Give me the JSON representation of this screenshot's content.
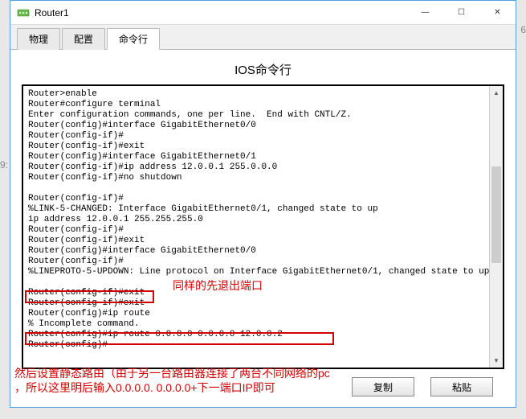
{
  "window": {
    "title": "Router1"
  },
  "tabs": {
    "items": [
      {
        "label": "物理"
      },
      {
        "label": "配置"
      },
      {
        "label": "命令行"
      }
    ]
  },
  "heading": "IOS命令行",
  "terminal": {
    "lines": "Router>enable\nRouter#configure terminal\nEnter configuration commands, one per line.  End with CNTL/Z.\nRouter(config)#interface GigabitEthernet0/0\nRouter(config-if)#\nRouter(config-if)#exit\nRouter(config)#interface GigabitEthernet0/1\nRouter(config-if)#ip address 12.0.0.1 255.0.0.0\nRouter(config-if)#no shutdown\n\nRouter(config-if)#\n%LINK-5-CHANGED: Interface GigabitEthernet0/1, changed state to up\nip address 12.0.0.1 255.255.255.0\nRouter(config-if)#\nRouter(config-if)#exit\nRouter(config)#interface GigabitEthernet0/0\nRouter(config-if)#\n%LINEPROTO-5-UPDOWN: Line protocol on Interface GigabitEthernet0/1, changed state to up\n\nRouter(config-if)#exit\nRouter(config-if)#exit\nRouter(config)#ip route\n% Incomplete command.\nRouter(config)#ip route 0.0.0.0 0.0.0.0 12.0.0.2\nRouter(config)#"
  },
  "buttons": {
    "copy": "复制",
    "paste": "粘贴"
  },
  "annotations": {
    "exit_note": "同样的先退出端口",
    "route_note_line1": "然后设置静态路由（由于另一台路由器连接了两台不同网络的pc",
    "route_note_line2": "，所以这里明后输入0.0.0.0.  0.0.0.0+下一端口IP即可"
  },
  "side": {
    "g6": "6",
    "g9": "9:"
  }
}
